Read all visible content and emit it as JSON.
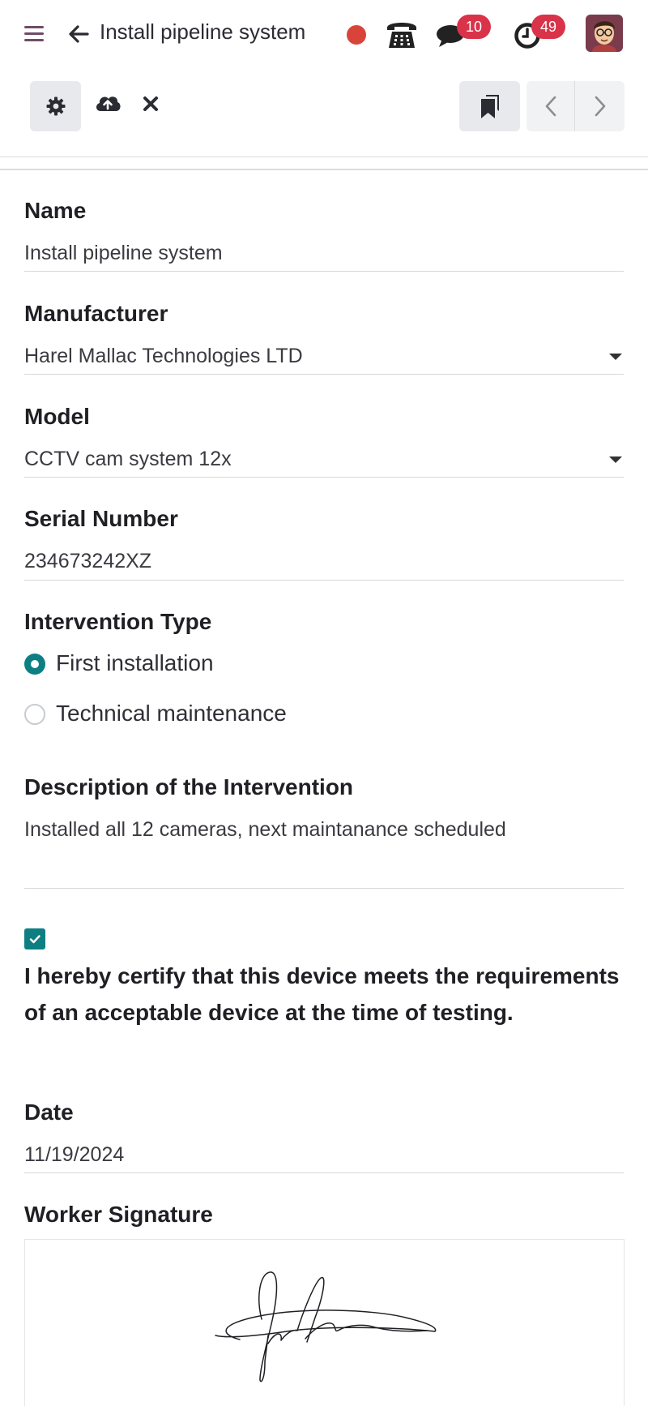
{
  "header": {
    "title": "Install pipeline system",
    "chat_count": "10",
    "activity_count": "49",
    "icons": [
      "menu-icon",
      "back-arrow-icon",
      "recording-dot-icon",
      "phone-icon",
      "chat-icon",
      "clock-icon",
      "avatar"
    ],
    "colors": {
      "brand": "#714b67",
      "badge": "#d9334a",
      "recording": "#d9443a"
    }
  },
  "controls": {
    "icons": [
      "gear-icon",
      "cloud-upload-icon",
      "close-icon",
      "bookmark-icon",
      "chevron-left-icon",
      "chevron-right-icon"
    ]
  },
  "form": {
    "name": {
      "label": "Name",
      "value": "Install pipeline system"
    },
    "manufacturer": {
      "label": "Manufacturer",
      "value": "Harel Mallac Technologies LTD"
    },
    "model": {
      "label": "Model",
      "value": "CCTV cam system 12x"
    },
    "serial": {
      "label": "Serial Number",
      "value": "234673242XZ"
    },
    "intervention": {
      "label": "Intervention Type",
      "options": [
        {
          "label": "First installation",
          "selected": true
        },
        {
          "label": "Technical maintenance",
          "selected": false
        }
      ]
    },
    "description": {
      "label": "Description of the Intervention",
      "value": "Installed all 12 cameras, next maintanance scheduled"
    },
    "certify": {
      "checked": true,
      "text": "I hereby certify that this device meets the requirements of an acceptable device at the time of testing."
    },
    "date": {
      "label": "Date",
      "value": "11/19/2024"
    },
    "signature": {
      "label": "Worker Signature"
    },
    "accent": "#0d7f83"
  }
}
